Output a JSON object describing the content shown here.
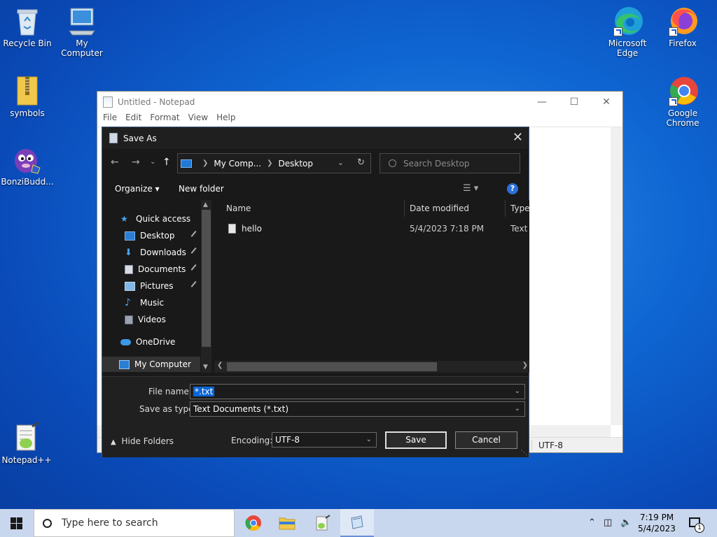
{
  "desktop": {
    "icons": [
      {
        "label": "Recycle Bin",
        "icon": "recycle-bin-icon"
      },
      {
        "label": "My Computer",
        "icon": "computer-icon"
      },
      {
        "label": "symbols",
        "icon": "zip-folder-icon"
      },
      {
        "label": "BonziBudd...",
        "icon": "bonzi-icon"
      },
      {
        "label": "Notepad++",
        "icon": "notepad-plus-plus-icon"
      },
      {
        "label": "Microsoft Edge",
        "label_line1": "Microsoft",
        "label_line2": "Edge",
        "icon": "edge-icon"
      },
      {
        "label": "Firefox",
        "icon": "firefox-icon"
      },
      {
        "label": "Google Chrome",
        "label_line1": "Google",
        "label_line2": "Chrome",
        "icon": "chrome-icon"
      }
    ]
  },
  "notepad": {
    "title": "Untitled - Notepad",
    "menu": [
      "File",
      "Edit",
      "Format",
      "View",
      "Help"
    ],
    "status_encoding": "UTF-8"
  },
  "dialog": {
    "title": "Save As",
    "address": {
      "crumb1": "My Comp...",
      "crumb2": "Desktop"
    },
    "search_placeholder": "Search Desktop",
    "toolbar": {
      "organize": "Organize",
      "new_folder": "New folder",
      "help": "?"
    },
    "nav_items": [
      {
        "label": "Quick access",
        "icon": "star-icon"
      },
      {
        "label": "Desktop",
        "icon": "desktop-folder-icon",
        "pinned": true
      },
      {
        "label": "Downloads",
        "icon": "downloads-icon",
        "pinned": true
      },
      {
        "label": "Documents",
        "icon": "documents-icon",
        "pinned": true
      },
      {
        "label": "Pictures",
        "icon": "pictures-icon",
        "pinned": true
      },
      {
        "label": "Music",
        "icon": "music-icon"
      },
      {
        "label": "Videos",
        "icon": "videos-icon"
      },
      {
        "label": "OneDrive",
        "icon": "cloud-icon"
      },
      {
        "label": "My Computer",
        "icon": "computer-icon"
      }
    ],
    "columns": [
      "Name",
      "Date modified",
      "Type"
    ],
    "files": [
      {
        "name": "hello",
        "date": "5/4/2023 7:18 PM",
        "type": "Text D"
      }
    ],
    "file_name_label": "File name:",
    "file_name_value": "*.txt",
    "save_type_label": "Save as type:",
    "save_type_value": "Text Documents (*.txt)",
    "hide_folders": "Hide Folders",
    "encoding_label": "Encoding:",
    "encoding_value": "UTF-8",
    "save_btn": "Save",
    "cancel_btn": "Cancel"
  },
  "taskbar": {
    "search_placeholder": "Type here to search",
    "time": "7:19 PM",
    "date": "5/4/2023",
    "notification_count": "1"
  }
}
